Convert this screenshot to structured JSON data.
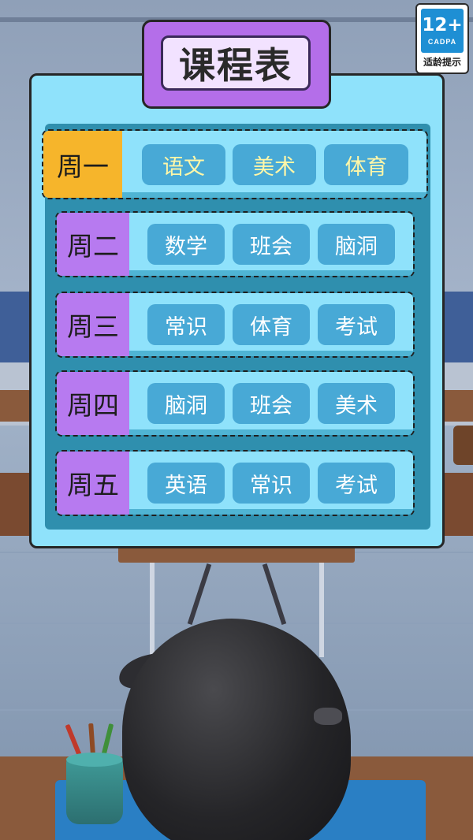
{
  "rating_badge": {
    "age": "12+",
    "org": "CADPA",
    "hint": "适龄提示"
  },
  "schedule": {
    "title": "课程表",
    "selected_day": 0,
    "days": [
      {
        "label": "周一",
        "subjects": [
          "语文",
          "美术",
          "体育"
        ]
      },
      {
        "label": "周二",
        "subjects": [
          "数学",
          "班会",
          "脑洞"
        ]
      },
      {
        "label": "周三",
        "subjects": [
          "常识",
          "体育",
          "考试"
        ]
      },
      {
        "label": "周四",
        "subjects": [
          "脑洞",
          "班会",
          "美术"
        ]
      },
      {
        "label": "周五",
        "subjects": [
          "英语",
          "常识",
          "考试"
        ]
      }
    ]
  },
  "colors": {
    "panel": "#8fe2fb",
    "panel_inner": "#2f8fae",
    "title_tab": "#b46ee9",
    "selected_day": "#f6b52b",
    "day_tab": "#b77af0",
    "subject_button": "#48a9d6",
    "selected_subject_text": "#fff7a8"
  }
}
